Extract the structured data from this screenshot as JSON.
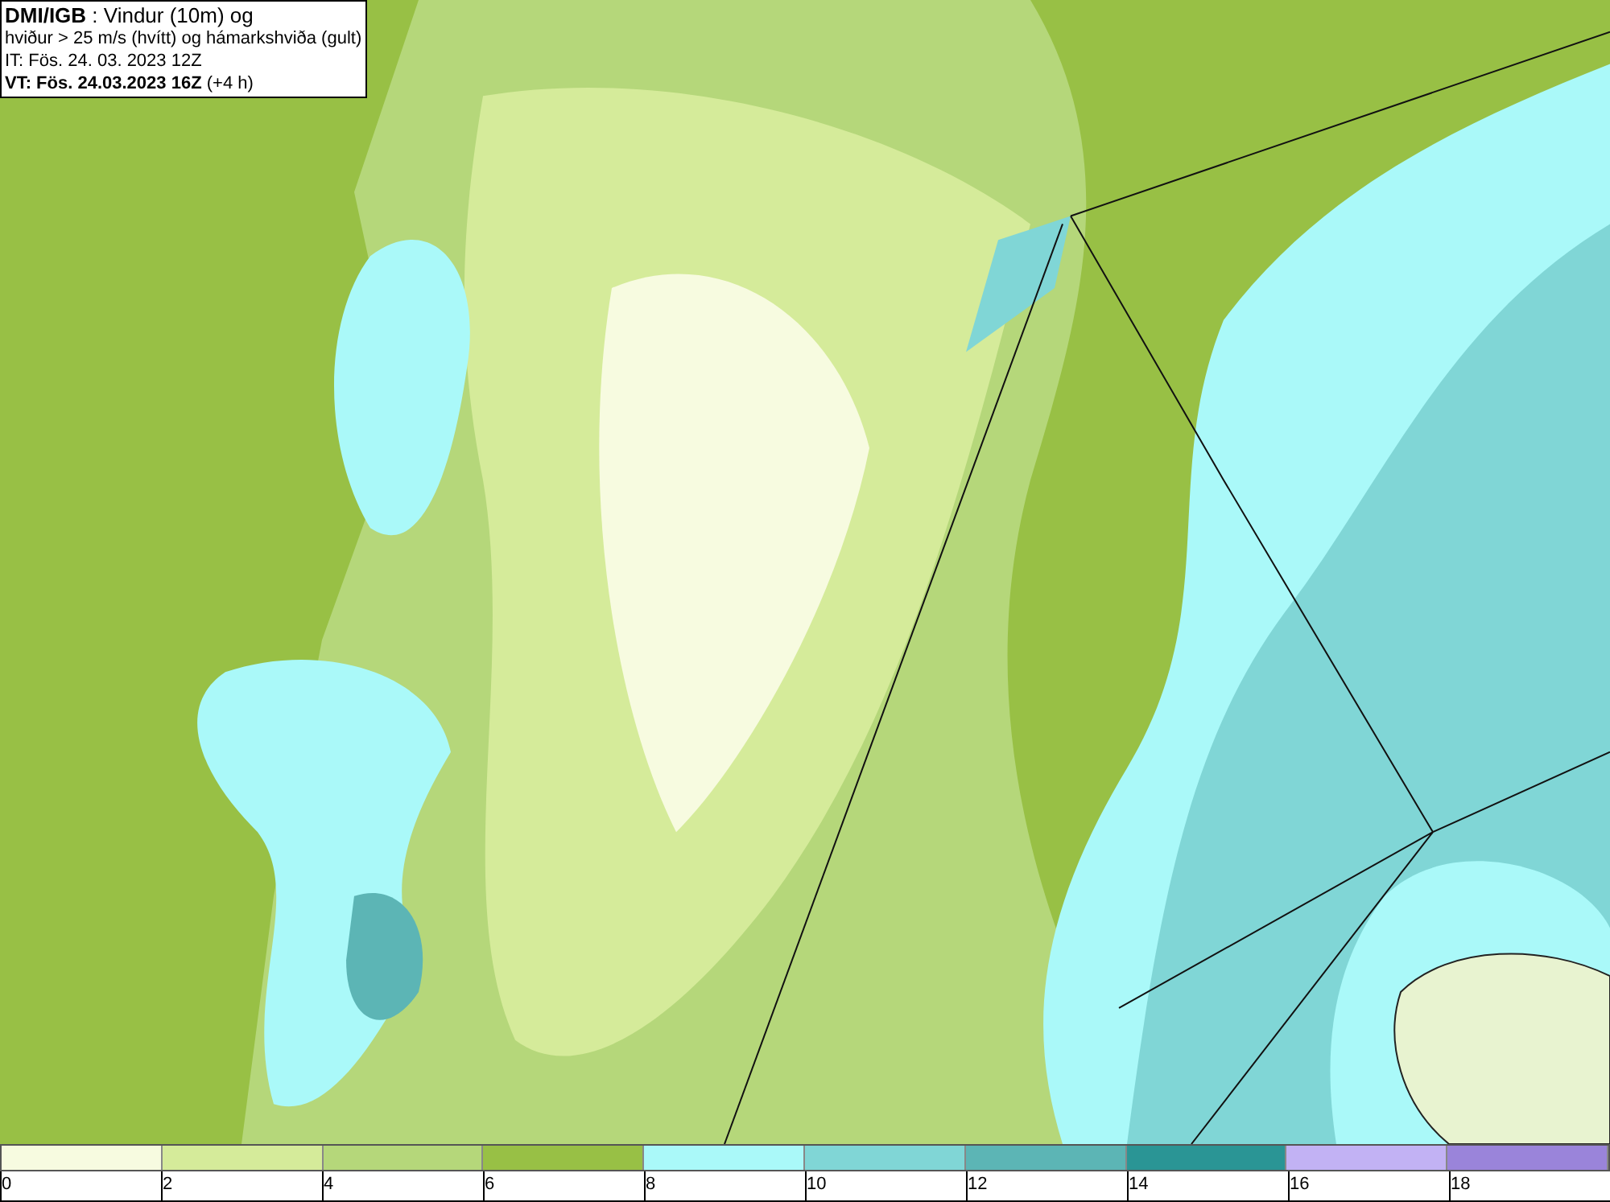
{
  "info_box": {
    "lines": [
      "**DMI/IGB** : Vindur (10m) og",
      "hviður > 25 m/s (hvítt) og hámarkshviða (gult)",
      "IT: Fös. 24. 03. 2023 12Z",
      "**VT: Fös. 24.03.2023 16Z** (+4 h)"
    ]
  },
  "legend": {
    "segments": [
      {
        "label": "0",
        "color": "#f7fbe0"
      },
      {
        "label": "2",
        "color": "#d5eb9a"
      },
      {
        "label": "4",
        "color": "#b5d77a"
      },
      {
        "label": "6",
        "color": "#98c045"
      },
      {
        "label": "8",
        "color": "#aaf9f9"
      },
      {
        "label": "10",
        "color": "#80d6d6"
      },
      {
        "label": "12",
        "color": "#5cb5b5"
      },
      {
        "label": "14",
        "color": "#2a9595"
      },
      {
        "label": "16",
        "color": "#c2b2f4"
      },
      {
        "label": "18",
        "color": "#9a84da"
      }
    ]
  }
}
